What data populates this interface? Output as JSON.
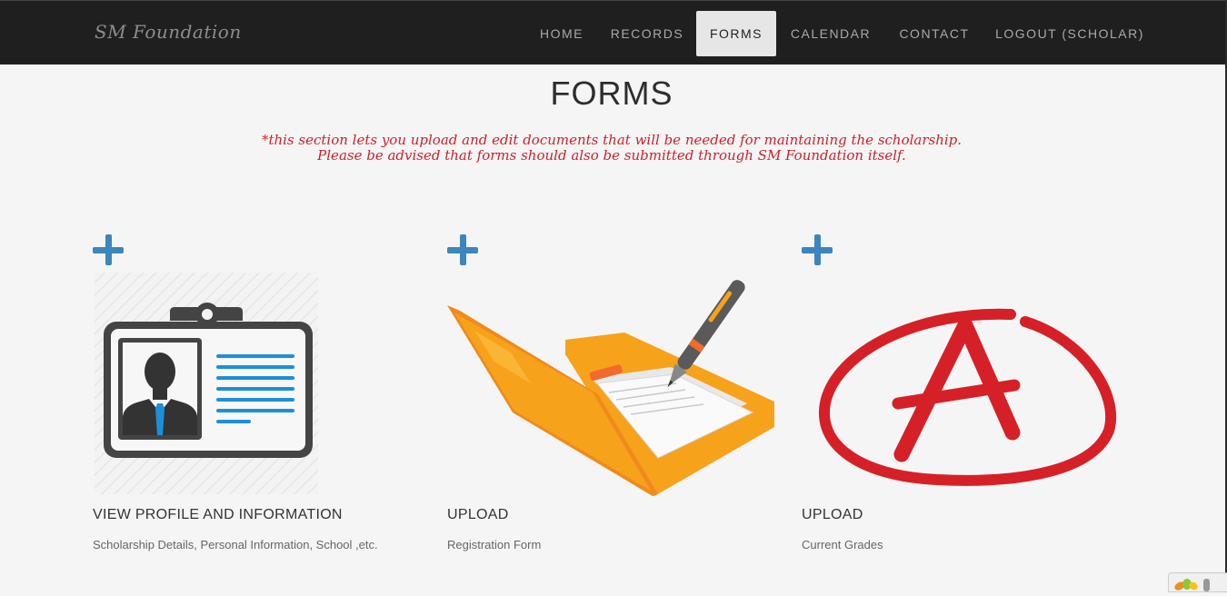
{
  "navbar": {
    "brand": "SM Foundation",
    "items": [
      {
        "label": "HOME",
        "active": false
      },
      {
        "label": "RECORDS",
        "active": false
      },
      {
        "label": "FORMS",
        "active": true
      },
      {
        "label": "CALENDAR",
        "active": false
      },
      {
        "label": "CONTACT",
        "active": false
      },
      {
        "label": "LOGOUT (SCHOLAR)",
        "active": false
      }
    ]
  },
  "page": {
    "title": "FORMS",
    "notice_line1": "*this section lets you upload and edit documents that will be needed for maintaining the scholarship.",
    "notice_line2": "Please be advised that forms should also be submitted through SM Foundation itself."
  },
  "cards": [
    {
      "title": "VIEW PROFILE AND INFORMATION",
      "subtitle": "Scholarship Details, Personal Information, School ,etc.",
      "icon": "id-card-icon"
    },
    {
      "title": "UPLOAD",
      "subtitle": "Registration Form",
      "icon": "folder-pen-icon"
    },
    {
      "title": "UPLOAD",
      "subtitle": "Current Grades",
      "icon": "grade-a-icon"
    }
  ],
  "colors": {
    "navbar_bg": "#1f1f1f",
    "accent_blue": "#3a86bd",
    "notice_red": "#d0202a",
    "grade_red": "#d62027",
    "folder_orange": "#f7a21b"
  }
}
